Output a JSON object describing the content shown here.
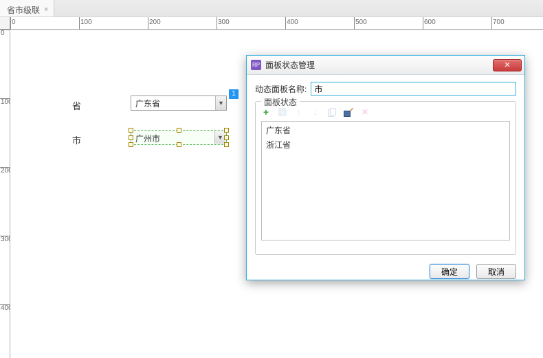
{
  "tab": {
    "title": "省市级联"
  },
  "ruler": {
    "h_ticks": [
      "0",
      "100",
      "200",
      "300",
      "400",
      "500",
      "600",
      "700"
    ],
    "v_ticks": [
      "0",
      "100",
      "200",
      "300",
      "400"
    ]
  },
  "form": {
    "province_label": "省",
    "province_value": "广东省",
    "city_label": "市",
    "city_value": "广州市",
    "note_badge": "1"
  },
  "dialog": {
    "title": "面板状态管理",
    "rp_badge": "RP",
    "name_label": "动态面板名称:",
    "name_value": "市",
    "fieldset_legend": "面板状态",
    "states": [
      "广东省",
      "浙江省"
    ],
    "ok": "确定",
    "cancel": "取消",
    "close_glyph": "✕"
  }
}
